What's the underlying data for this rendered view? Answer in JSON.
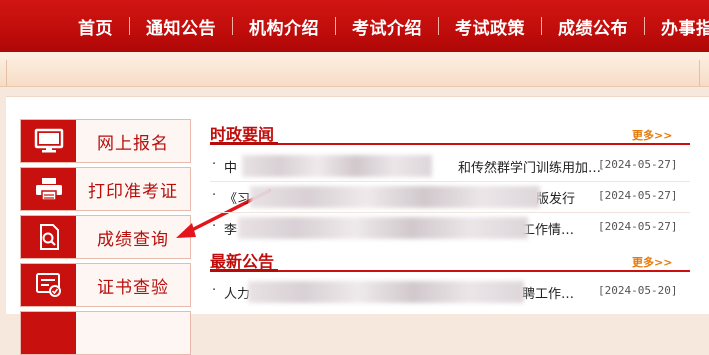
{
  "nav": {
    "items": [
      "首页",
      "通知公告",
      "机构介绍",
      "考试介绍",
      "考试政策",
      "成绩公布",
      "办事指南"
    ]
  },
  "sidebar": {
    "items": [
      {
        "label": "网上报名",
        "icon": "monitor-icon"
      },
      {
        "label": "打印准考证",
        "icon": "printer-icon"
      },
      {
        "label": "成绩查询",
        "icon": "document-search-icon"
      },
      {
        "label": "证书查验",
        "icon": "certificate-check-icon"
      }
    ]
  },
  "sections": {
    "politics": {
      "title": "时政要闻",
      "more": "更多>>",
      "items": [
        {
          "title_start": "中",
          "title_end": "和传然群学门训练用加…",
          "date": "[2024-05-27]"
        },
        {
          "title_start": "《习",
          "title_end": "版发行",
          "date": "[2024-05-27]"
        },
        {
          "title_start": "李",
          "title_end": "工作情…",
          "date": "[2024-05-27]"
        }
      ]
    },
    "notices": {
      "title": "最新公告",
      "more": "更多>>",
      "items": [
        {
          "title_start": "人力",
          "title_end": "聘工作…",
          "date": "[2024-05-20]"
        }
      ]
    }
  },
  "colors": {
    "brand_red": "#c8100e",
    "accent_orange": "#e67a0a",
    "page_bg": "#f6e8dc"
  }
}
